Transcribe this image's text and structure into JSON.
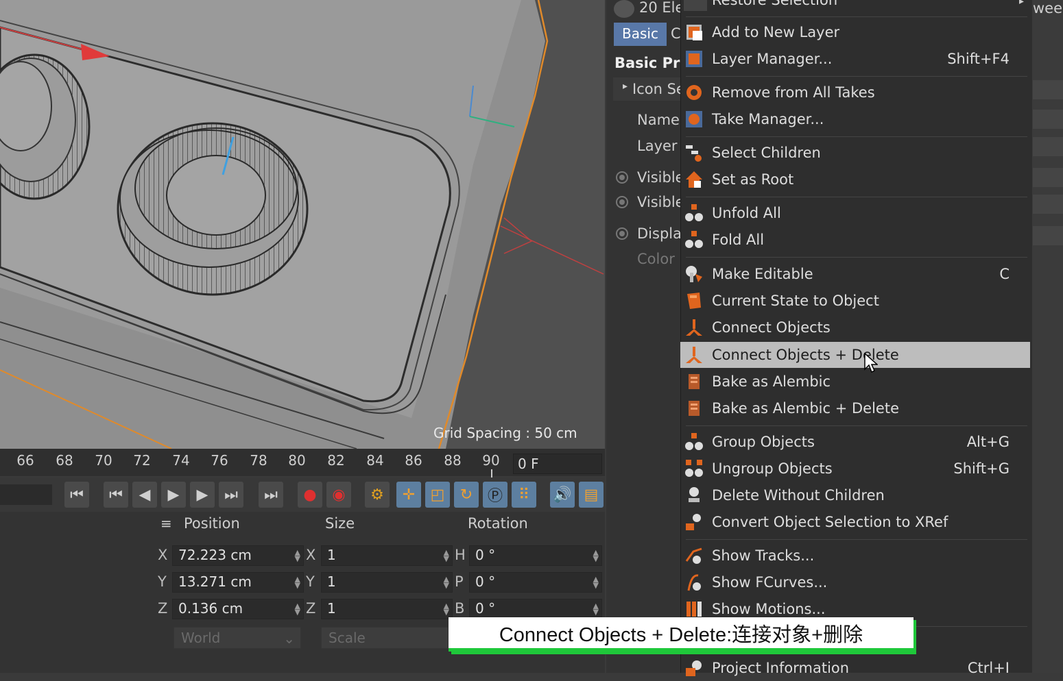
{
  "viewport": {
    "grid_spacing": "Grid Spacing : 50 cm"
  },
  "timeline": {
    "ticks": [
      "66",
      "68",
      "70",
      "72",
      "74",
      "76",
      "78",
      "80",
      "82",
      "84",
      "86",
      "88",
      "90"
    ],
    "frame": "0 F"
  },
  "coordinates": {
    "headers": {
      "position": "Position",
      "size": "Size",
      "rotation": "Rotation"
    },
    "position": {
      "x_label": "X",
      "x": "72.223 cm",
      "y_label": "Y",
      "y": "13.271 cm",
      "z_label": "Z",
      "z": "0.136 cm"
    },
    "size": {
      "x_label": "X",
      "x": "1",
      "y_label": "Y",
      "y": "1",
      "z_label": "Z",
      "z": "1"
    },
    "rotation": {
      "h_label": "H",
      "h": "0 °",
      "p_label": "P",
      "p": "0 °",
      "b_label": "B",
      "b": "0 °"
    },
    "coord_system": "World",
    "size_mode": "Scale"
  },
  "attributes": {
    "object_name": "20 Ele",
    "tab_basic": "Basic",
    "tab_next": "C",
    "section": "Basic Pro",
    "icon_setting": "Icon Se",
    "name_label": "Name",
    "layer_label": "Layer",
    "visible_editor": "Visible",
    "visible_render": "Visible",
    "display_color": "Displa",
    "color_label": "Color"
  },
  "menu": {
    "top_partial": "Restore Selection",
    "items": [
      {
        "label": "Add to New Layer",
        "shortcut": ""
      },
      {
        "label": "Layer Manager...",
        "shortcut": "Shift+F4"
      },
      {
        "label": "Remove from All Takes",
        "shortcut": ""
      },
      {
        "label": "Take Manager...",
        "shortcut": ""
      },
      {
        "label": "Select Children",
        "shortcut": ""
      },
      {
        "label": "Set as Root",
        "shortcut": ""
      },
      {
        "label": "Unfold All",
        "shortcut": ""
      },
      {
        "label": "Fold All",
        "shortcut": ""
      },
      {
        "label": "Make Editable",
        "shortcut": "C"
      },
      {
        "label": "Current State to Object",
        "shortcut": ""
      },
      {
        "label": "Connect Objects",
        "shortcut": ""
      },
      {
        "label": "Connect Objects + Delete",
        "shortcut": ""
      },
      {
        "label": "Bake as Alembic",
        "shortcut": ""
      },
      {
        "label": "Bake as Alembic + Delete",
        "shortcut": ""
      },
      {
        "label": "Group Objects",
        "shortcut": "Alt+G"
      },
      {
        "label": "Ungroup Objects",
        "shortcut": "Shift+G"
      },
      {
        "label": "Delete Without Children",
        "shortcut": ""
      },
      {
        "label": "Convert Object Selection to XRef",
        "shortcut": ""
      },
      {
        "label": "Show Tracks...",
        "shortcut": ""
      },
      {
        "label": "Show FCurves...",
        "shortcut": ""
      },
      {
        "label": "Show Motions...",
        "shortcut": ""
      },
      {
        "label": "Project Information",
        "shortcut": "Ctrl+I"
      }
    ]
  },
  "right_strip": {
    "partial": "weep"
  },
  "caption": "Connect Objects + Delete:连接对象+删除",
  "colors": {
    "accent_blue": "#5978a8",
    "highlight": "#bdbdbd",
    "caption_green": "#1fc83a",
    "icon_orange": "#e0651e"
  }
}
